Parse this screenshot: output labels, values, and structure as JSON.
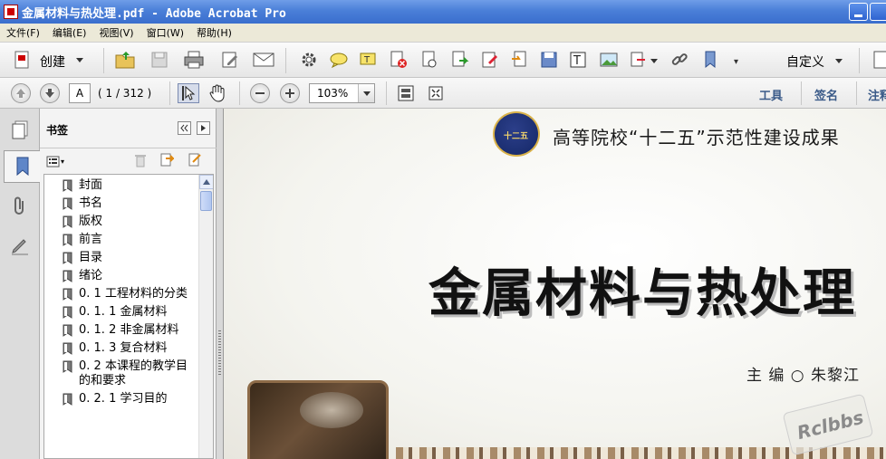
{
  "window": {
    "title": "金属材料与热处理.pdf - Adobe Acrobat Pro"
  },
  "menubar": {
    "items": [
      "文件(F)",
      "编辑(E)",
      "视图(V)",
      "窗口(W)",
      "帮助(H)"
    ]
  },
  "toolbar": {
    "create_label": "创建",
    "custom_label": "自定义"
  },
  "navigation": {
    "page_input": "A",
    "page_count": "( 1 / 312 )",
    "zoom": "103%"
  },
  "right_panel_links": {
    "tools": "工具",
    "sign": "签名",
    "comment": "注释"
  },
  "bookmarks": {
    "title": "书签",
    "items": [
      "封面",
      "书名",
      "版权",
      "前言",
      "目录",
      "绪论",
      "0. 1 工程材料的分类",
      "0. 1. 1 金属材料",
      "0. 1. 2 非金属材料",
      "0. 1. 3 复合材料",
      "0. 2 本课程的教学目的和要求",
      "0. 2. 1 学习目的"
    ]
  },
  "document": {
    "emblem_text": "十二五",
    "series_title": "高等院校“十二五”示范性建设成果",
    "book_title": "金属材料与热处理",
    "editor": "主 编 ○ 朱黎江",
    "watermark": "Rclbbs"
  },
  "colors": {
    "titlebar": "#4a7fd8",
    "link_text": "#3a5a88",
    "emblem_bg": "#142766",
    "emblem_ring": "#d9b24a"
  },
  "icons": {
    "app": "acrobat-icon",
    "bookmark": "bookmark-icon"
  }
}
